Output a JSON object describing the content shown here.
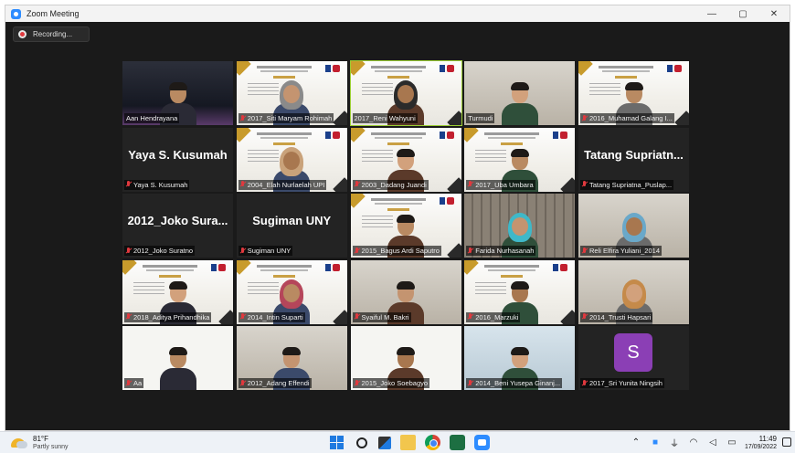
{
  "window": {
    "title": "Zoom Meeting",
    "controls": {
      "minimize": "—",
      "maximize": "▢",
      "close": "✕"
    }
  },
  "recording": {
    "label": "Recording..."
  },
  "participants": [
    {
      "label": "Aan Hendrayana",
      "big_name": "",
      "video": "dark",
      "muted": false
    },
    {
      "label": "2017_Siti Maryam Rohimah",
      "big_name": "",
      "video": "slide",
      "muted": true
    },
    {
      "label": "2017_Reni Wahyuni",
      "big_name": "",
      "video": "slide",
      "muted": false,
      "active": true
    },
    {
      "label": "Turmudi",
      "big_name": "",
      "video": "room",
      "muted": false
    },
    {
      "label": "2016_Muhamad Galang I...",
      "big_name": "",
      "video": "slide",
      "muted": true
    },
    {
      "label": "Yaya S. Kusumah",
      "big_name": "Yaya S. Kusumah",
      "video": "none",
      "muted": true
    },
    {
      "label": "2004_Elah Nurlaelah UPI",
      "big_name": "",
      "video": "slide",
      "muted": true
    },
    {
      "label": "2003_Dadang Juandi",
      "big_name": "",
      "video": "slide",
      "muted": true
    },
    {
      "label": "2017_Uba Umbara",
      "big_name": "",
      "video": "slide",
      "muted": true
    },
    {
      "label": "Tatang Supriatna_Puslap...",
      "big_name": "Tatang Supriatn...",
      "video": "none",
      "muted": true
    },
    {
      "label": "2012_Joko Suratno",
      "big_name": "2012_Joko Sura...",
      "video": "none",
      "muted": true
    },
    {
      "label": "Sugiman UNY",
      "big_name": "Sugiman UNY",
      "video": "none",
      "muted": true
    },
    {
      "label": "2015_Bagus Ardi Saputro",
      "big_name": "",
      "video": "slide",
      "muted": true
    },
    {
      "label": "Farida Nurhasanah",
      "big_name": "",
      "video": "building",
      "muted": true
    },
    {
      "label": "Reli Elfira Yuliani_2014",
      "big_name": "",
      "video": "room",
      "muted": true
    },
    {
      "label": "2018_Aditya Prihandhika",
      "big_name": "",
      "video": "slide",
      "muted": true
    },
    {
      "label": "2014_Intin Suparti",
      "big_name": "",
      "video": "slide",
      "muted": true
    },
    {
      "label": "Syaiful M. Bakri",
      "big_name": "",
      "video": "room",
      "muted": true
    },
    {
      "label": "2016_Marzuki",
      "big_name": "",
      "video": "slide",
      "muted": true
    },
    {
      "label": "2014_Trusti Hapsari",
      "big_name": "",
      "video": "room",
      "muted": true
    },
    {
      "label": "Aa",
      "big_name": "",
      "video": "white",
      "muted": true
    },
    {
      "label": "2012_Adang Effendi",
      "big_name": "",
      "video": "room",
      "muted": true
    },
    {
      "label": "2015_Joko Soebagyo",
      "big_name": "",
      "video": "white",
      "muted": true
    },
    {
      "label": "2014_Beni Yusepa Ginanj...",
      "big_name": "",
      "video": "blue",
      "muted": true
    },
    {
      "label": "2017_Sri Yunita Ningsih",
      "big_name": "",
      "video": "avatar",
      "avatar_letter": "S",
      "muted": true
    }
  ],
  "taskbar": {
    "weather_temp": "81°F",
    "weather_cond": "Partly sunny",
    "time": "11:49",
    "date": "17/09/2022",
    "tray_icons": [
      "chevron-up-icon",
      "zoom-tray-icon",
      "usb-icon",
      "wifi-icon",
      "volume-icon",
      "battery-icon"
    ]
  },
  "colors": {
    "active_border": "#9acd32",
    "muted_icon": "#e0393e",
    "avatar": "#8b3fb5",
    "zoom_blue": "#2d8cff"
  }
}
